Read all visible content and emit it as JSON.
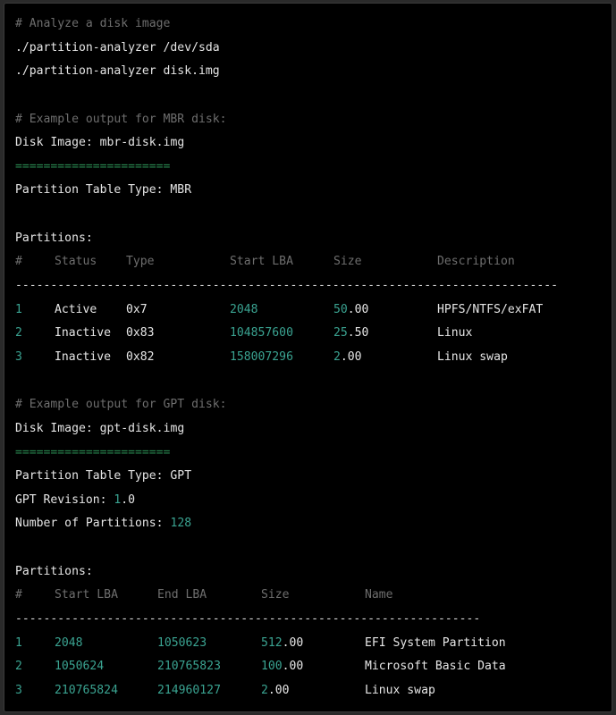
{
  "colors": {
    "background": "#000000",
    "text": "#e6e6e6",
    "comment": "#6e6e6e",
    "number": "#3aa391",
    "separator_green": "#2a8a52"
  },
  "usage": {
    "comment": "# Analyze a disk image",
    "cmd1": "./partition-analyzer /dev/sda",
    "cmd2": "./partition-analyzer disk.img"
  },
  "mbr": {
    "comment": "# Example output for MBR disk:",
    "disk_label": "Disk Image: ",
    "disk_value": "mbr-disk.img",
    "separator": "======================",
    "table_type": "Partition Table Type: MBR",
    "partitions_heading": "Partitions:",
    "headers": {
      "num": "#",
      "status": "Status",
      "type": "Type",
      "start": "Start LBA",
      "size": "Size",
      "desc": "Description"
    },
    "rule": "-----------------------------------------------------------------------------",
    "rows": [
      {
        "num": "1",
        "status": "Active",
        "type": "0x7",
        "start": "2048",
        "size_int": "50",
        "size_dec": ".00",
        "desc": "HPFS/NTFS/exFAT"
      },
      {
        "num": "2",
        "status": "Inactive",
        "type": "0x83",
        "start": "104857600",
        "size_int": "25",
        "size_dec": ".50",
        "desc": "Linux"
      },
      {
        "num": "3",
        "status": "Inactive",
        "type": "0x82",
        "start": "158007296",
        "size_int": "2",
        "size_dec": ".00",
        "desc": "Linux swap"
      }
    ]
  },
  "gpt": {
    "comment": "# Example output for GPT disk:",
    "disk_label": "Disk Image: ",
    "disk_value": "gpt-disk.img",
    "separator": "======================",
    "table_type": "Partition Table Type: GPT",
    "revision_label": "GPT Revision: ",
    "revision_int": "1",
    "revision_dec": ".0",
    "count_label": "Number of Partitions: ",
    "count_value": "128",
    "partitions_heading": "Partitions:",
    "headers": {
      "num": "#",
      "start": "Start LBA",
      "end": "End LBA",
      "size": "Size",
      "name": "Name"
    },
    "rule": "------------------------------------------------------------------",
    "rows": [
      {
        "num": "1",
        "start": "2048",
        "end": "1050623",
        "size_int": "512",
        "size_dec": ".00",
        "name": "EFI System Partition"
      },
      {
        "num": "2",
        "start": "1050624",
        "end": "210765823",
        "size_int": "100",
        "size_dec": ".00",
        "name": "Microsoft Basic Data"
      },
      {
        "num": "3",
        "start": "210765824",
        "end": "214960127",
        "size_int": "2",
        "size_dec": ".00",
        "name": "Linux swap"
      }
    ]
  }
}
